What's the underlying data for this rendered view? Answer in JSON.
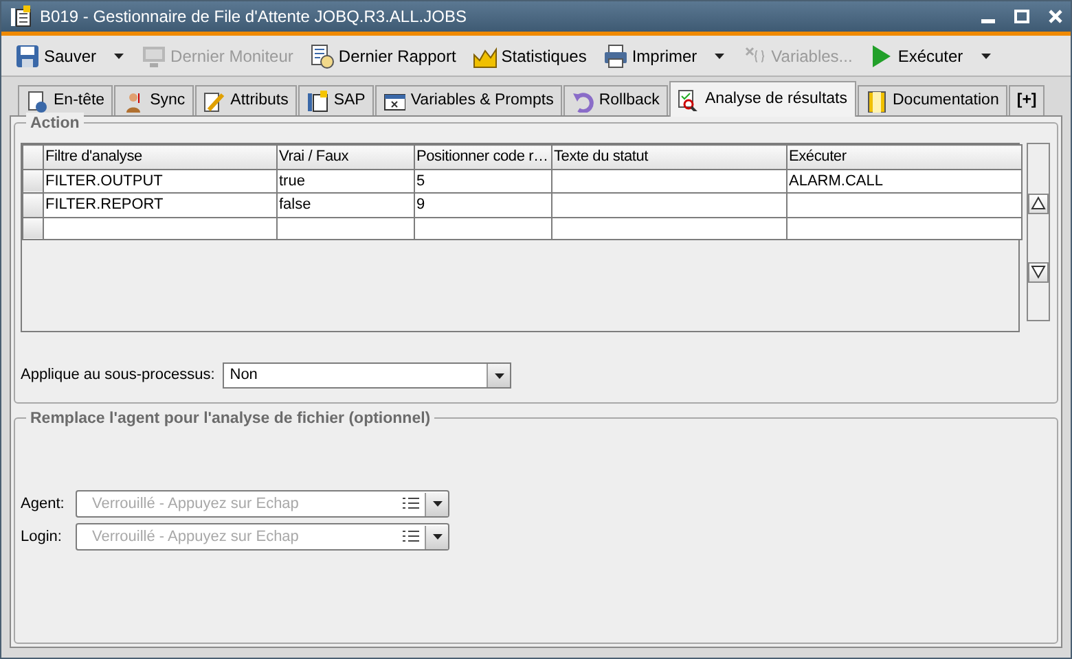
{
  "window": {
    "title": "B019 - Gestionnaire de File d'Attente JOBQ.R3.ALL.JOBS"
  },
  "toolbar": [
    {
      "label": "Sauver",
      "disabled": false,
      "dropdown": true
    },
    {
      "label": "Dernier Moniteur",
      "disabled": true,
      "dropdown": false
    },
    {
      "label": "Dernier Rapport",
      "disabled": false,
      "dropdown": false
    },
    {
      "label": "Statistiques",
      "disabled": false,
      "dropdown": false
    },
    {
      "label": "Imprimer",
      "disabled": false,
      "dropdown": true
    },
    {
      "label": "Variables...",
      "disabled": true,
      "dropdown": false
    },
    {
      "label": "Exécuter",
      "disabled": false,
      "dropdown": true
    }
  ],
  "tabs": [
    {
      "label": "En-tête",
      "selected": false
    },
    {
      "label": "Sync",
      "selected": false
    },
    {
      "label": "Attributs",
      "selected": false
    },
    {
      "label": "SAP",
      "selected": false
    },
    {
      "label": "Variables & Prompts",
      "selected": false
    },
    {
      "label": "Rollback",
      "selected": false
    },
    {
      "label": "Analyse de résultats",
      "selected": true
    },
    {
      "label": "Documentation",
      "selected": false
    },
    {
      "label": "[+]",
      "selected": false
    }
  ],
  "action": {
    "title": "Action",
    "table": {
      "columns": [
        "Filtre d'analyse",
        "Vrai / Faux",
        "Positionner code r…",
        "Texte du statut",
        "Exécuter"
      ],
      "rows": [
        [
          "FILTER.OUTPUT",
          "true",
          "5",
          "",
          "ALARM.CALL"
        ],
        [
          "FILTER.REPORT",
          "false",
          "9",
          "",
          ""
        ],
        [
          "",
          "",
          "",
          "",
          ""
        ]
      ]
    },
    "subprocess": {
      "label": "Applique au sous-processus:",
      "value": "Non"
    }
  },
  "agent_override": {
    "title": "Remplace l'agent pour l'analyse de fichier (optionnel)",
    "fields": [
      {
        "label": "Agent:",
        "placeholder": "Verrouillé - Appuyez sur Echap"
      },
      {
        "label": "Login:",
        "placeholder": "Verrouillé - Appuyez sur Echap"
      }
    ]
  }
}
